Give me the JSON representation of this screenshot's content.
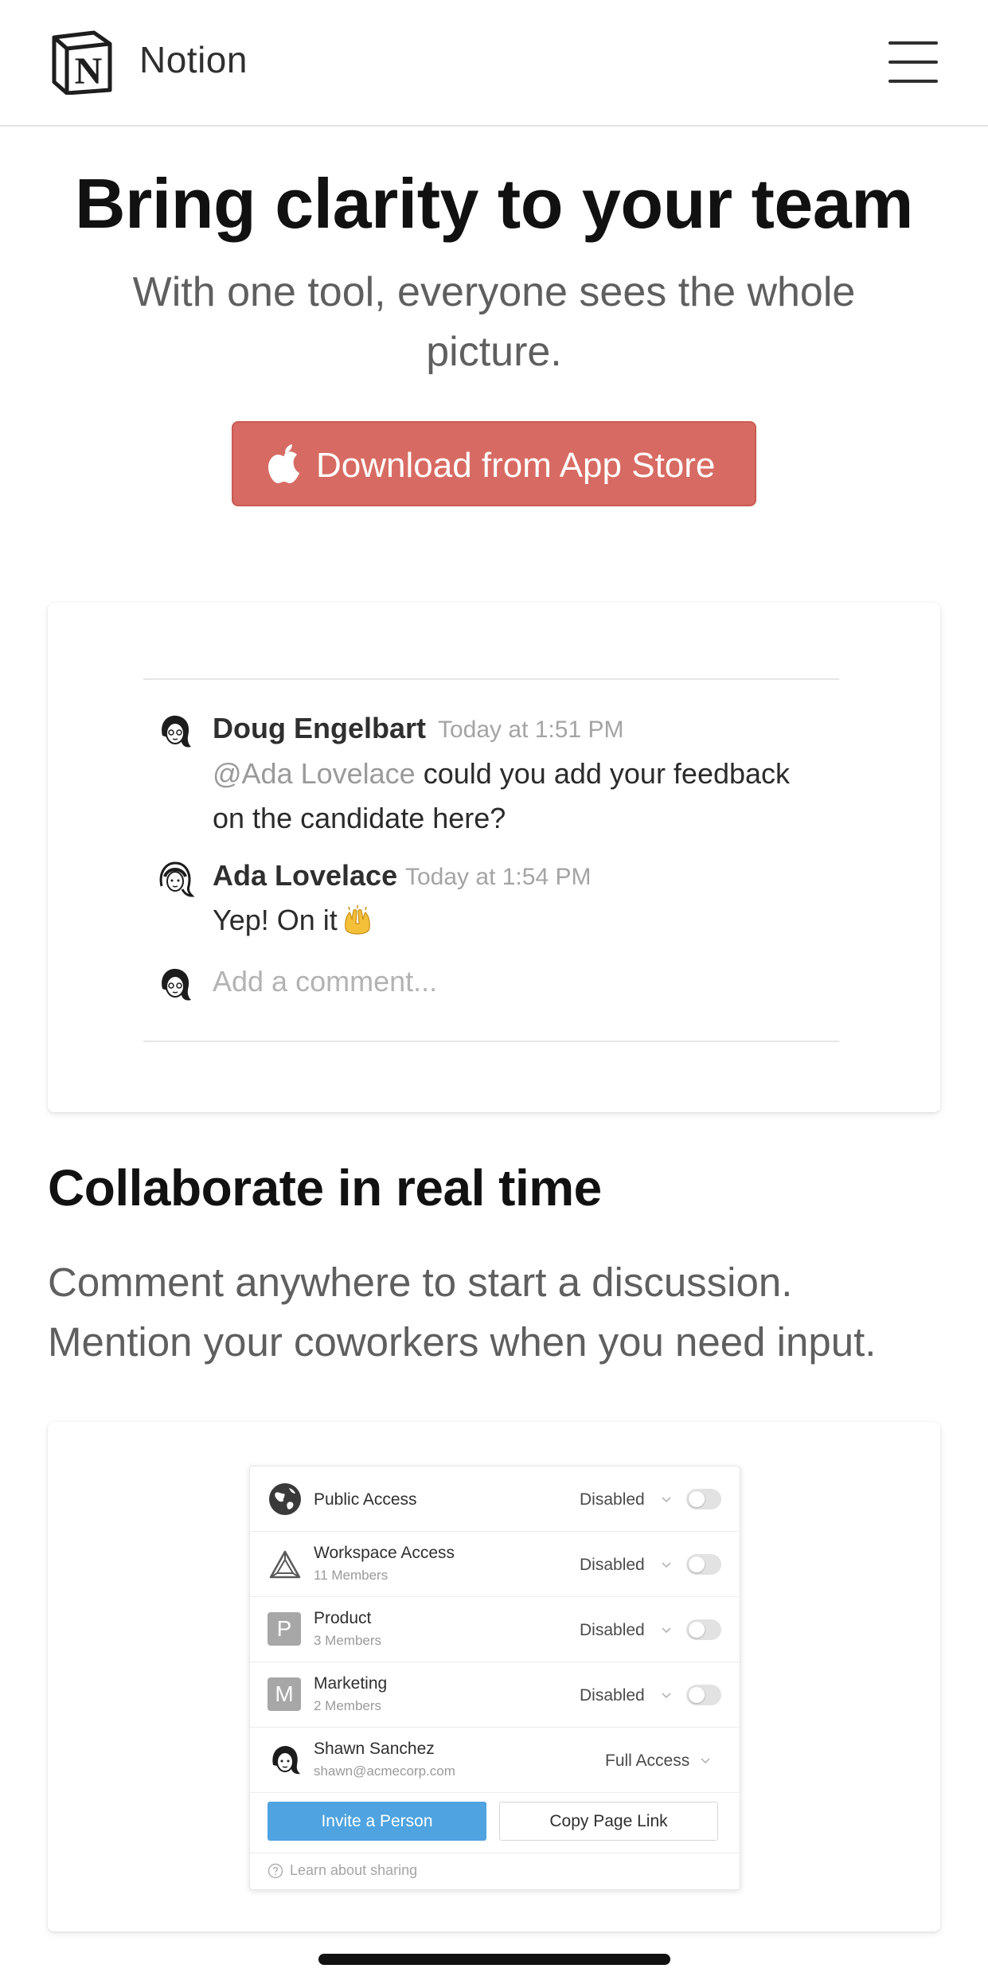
{
  "header": {
    "brand": "Notion",
    "logo_icon": "notion-logo-icon",
    "menu_icon": "hamburger-menu-icon"
  },
  "hero": {
    "title": "Bring clarity to your team",
    "subtitle": "With one tool, everyone sees the whole picture.",
    "cta_label": "Download from App Store",
    "cta_icon": "apple-icon",
    "cta_color": "#d76b63"
  },
  "comments": {
    "items": [
      {
        "author": "Doug Engelbart",
        "time": "Today at 1:51 PM",
        "mention": "@Ada Lovelace",
        "text_line1": " could you add your feedback",
        "text_line2": "on the candidate here?"
      },
      {
        "author": "Ada Lovelace",
        "time": "Today at 1:54 PM",
        "text": "Yep! On it",
        "emoji": "raised-hands-emoji"
      }
    ],
    "input_placeholder": "Add a comment..."
  },
  "collaborate": {
    "title": "Collaborate in real time",
    "text_line1": "Comment anywhere to start a discussion.",
    "text_line2": "Mention your coworkers when you need input."
  },
  "sharing": {
    "rows": [
      {
        "name": "Public Access",
        "access": "Disabled",
        "icon": "globe-icon"
      },
      {
        "name": "Workspace Access",
        "sub": "11 Members",
        "access": "Disabled",
        "icon": "workspace-triangle-icon"
      },
      {
        "name": "Product",
        "sub": "3 Members",
        "access": "Disabled",
        "letter": "P"
      },
      {
        "name": "Marketing",
        "sub": "2 Members",
        "access": "Disabled",
        "letter": "M"
      },
      {
        "name": "Shawn Sanchez",
        "sub": "shawn@acmecorp.com",
        "access": "Full Access",
        "icon": "avatar-icon"
      }
    ],
    "invite_label": "Invite a Person",
    "invite_color": "#4ea3e0",
    "copy_label": "Copy Page Link",
    "footer_text": "Learn about sharing"
  }
}
